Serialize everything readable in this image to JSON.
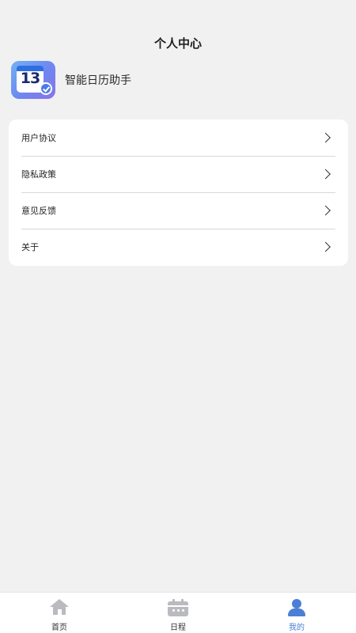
{
  "header": {
    "title": "个人中心"
  },
  "app": {
    "icon_number": "13",
    "name": "智能日历助手"
  },
  "menu": {
    "items": [
      {
        "label": "用户协议"
      },
      {
        "label": "隐私政策"
      },
      {
        "label": "意见反馈"
      },
      {
        "label": "关于"
      }
    ]
  },
  "tabbar": {
    "tabs": [
      {
        "label": "首页",
        "icon": "home-icon",
        "active": false
      },
      {
        "label": "日程",
        "icon": "calendar-icon",
        "active": false
      },
      {
        "label": "我的",
        "icon": "person-icon",
        "active": true
      }
    ]
  },
  "colors": {
    "background": "#f1f1f2",
    "card": "#ffffff",
    "accent": "#4a7fd6",
    "inactive_icon": "#b9bbbf"
  }
}
